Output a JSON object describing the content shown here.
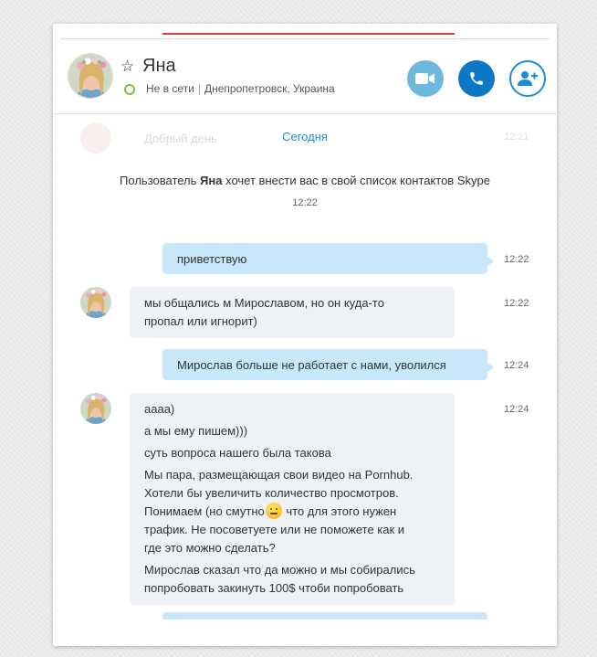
{
  "contact": {
    "name": "Яна",
    "status": "Не в сети",
    "location": "Днепропетровск, Украина"
  },
  "date_separator": "Сегодня",
  "faded_message": {
    "text": "Добрый день",
    "time": "12:21"
  },
  "system_message": {
    "prefix": "Пользователь",
    "name": "Яна",
    "suffix": "хочет внести вас в свой список контактов Skype",
    "time": "12:22"
  },
  "messages": [
    {
      "dir": "out",
      "text": "приветствую",
      "time": "12:22"
    },
    {
      "dir": "in",
      "lines": [
        "мы общались м Мирославом, но он куда-то",
        "пропал или игнорит)"
      ],
      "time": "12:22"
    },
    {
      "dir": "out",
      "text": "Мирослав больше не работает с нами, уволился",
      "time": "12:24"
    },
    {
      "dir": "in",
      "time": "12:24",
      "p1": "аааа)",
      "p2": "а мы ему пишем)))",
      "p3": "суть вопроса нашего была такова",
      "p4_l1": "Мы пара, размещающая свои видео на Pornhub.",
      "p4_l2": "Хотели бы увеличить количество просмотров.",
      "p4_l3a": "Понимаем (но смутно",
      "p4_l3b": " что для этого нужен",
      "p4_l4": "трафик. Не посоветуете или не поможете как и",
      "p4_l5": "где это можно сделать?",
      "p5_l1": "Мирослав сказал что да можно и мы собирались",
      "p5_l2": "попробовать закинуть 100$ чтоби попробовать"
    }
  ],
  "icons": {
    "favorite": "star-outline-icon",
    "status": "offline-circle-icon",
    "video": "video-camera-icon",
    "call": "phone-icon",
    "add_contact": "add-person-icon",
    "emoji": "smiley-icon"
  },
  "colors": {
    "accent_blue": "#0d78c4",
    "light_blue": "#6db9dd",
    "outgoing_bubble": "#c7e8f8",
    "incoming_bubble": "#eef1f5",
    "status_green": "#7cc243",
    "red_line": "#d6413f"
  }
}
